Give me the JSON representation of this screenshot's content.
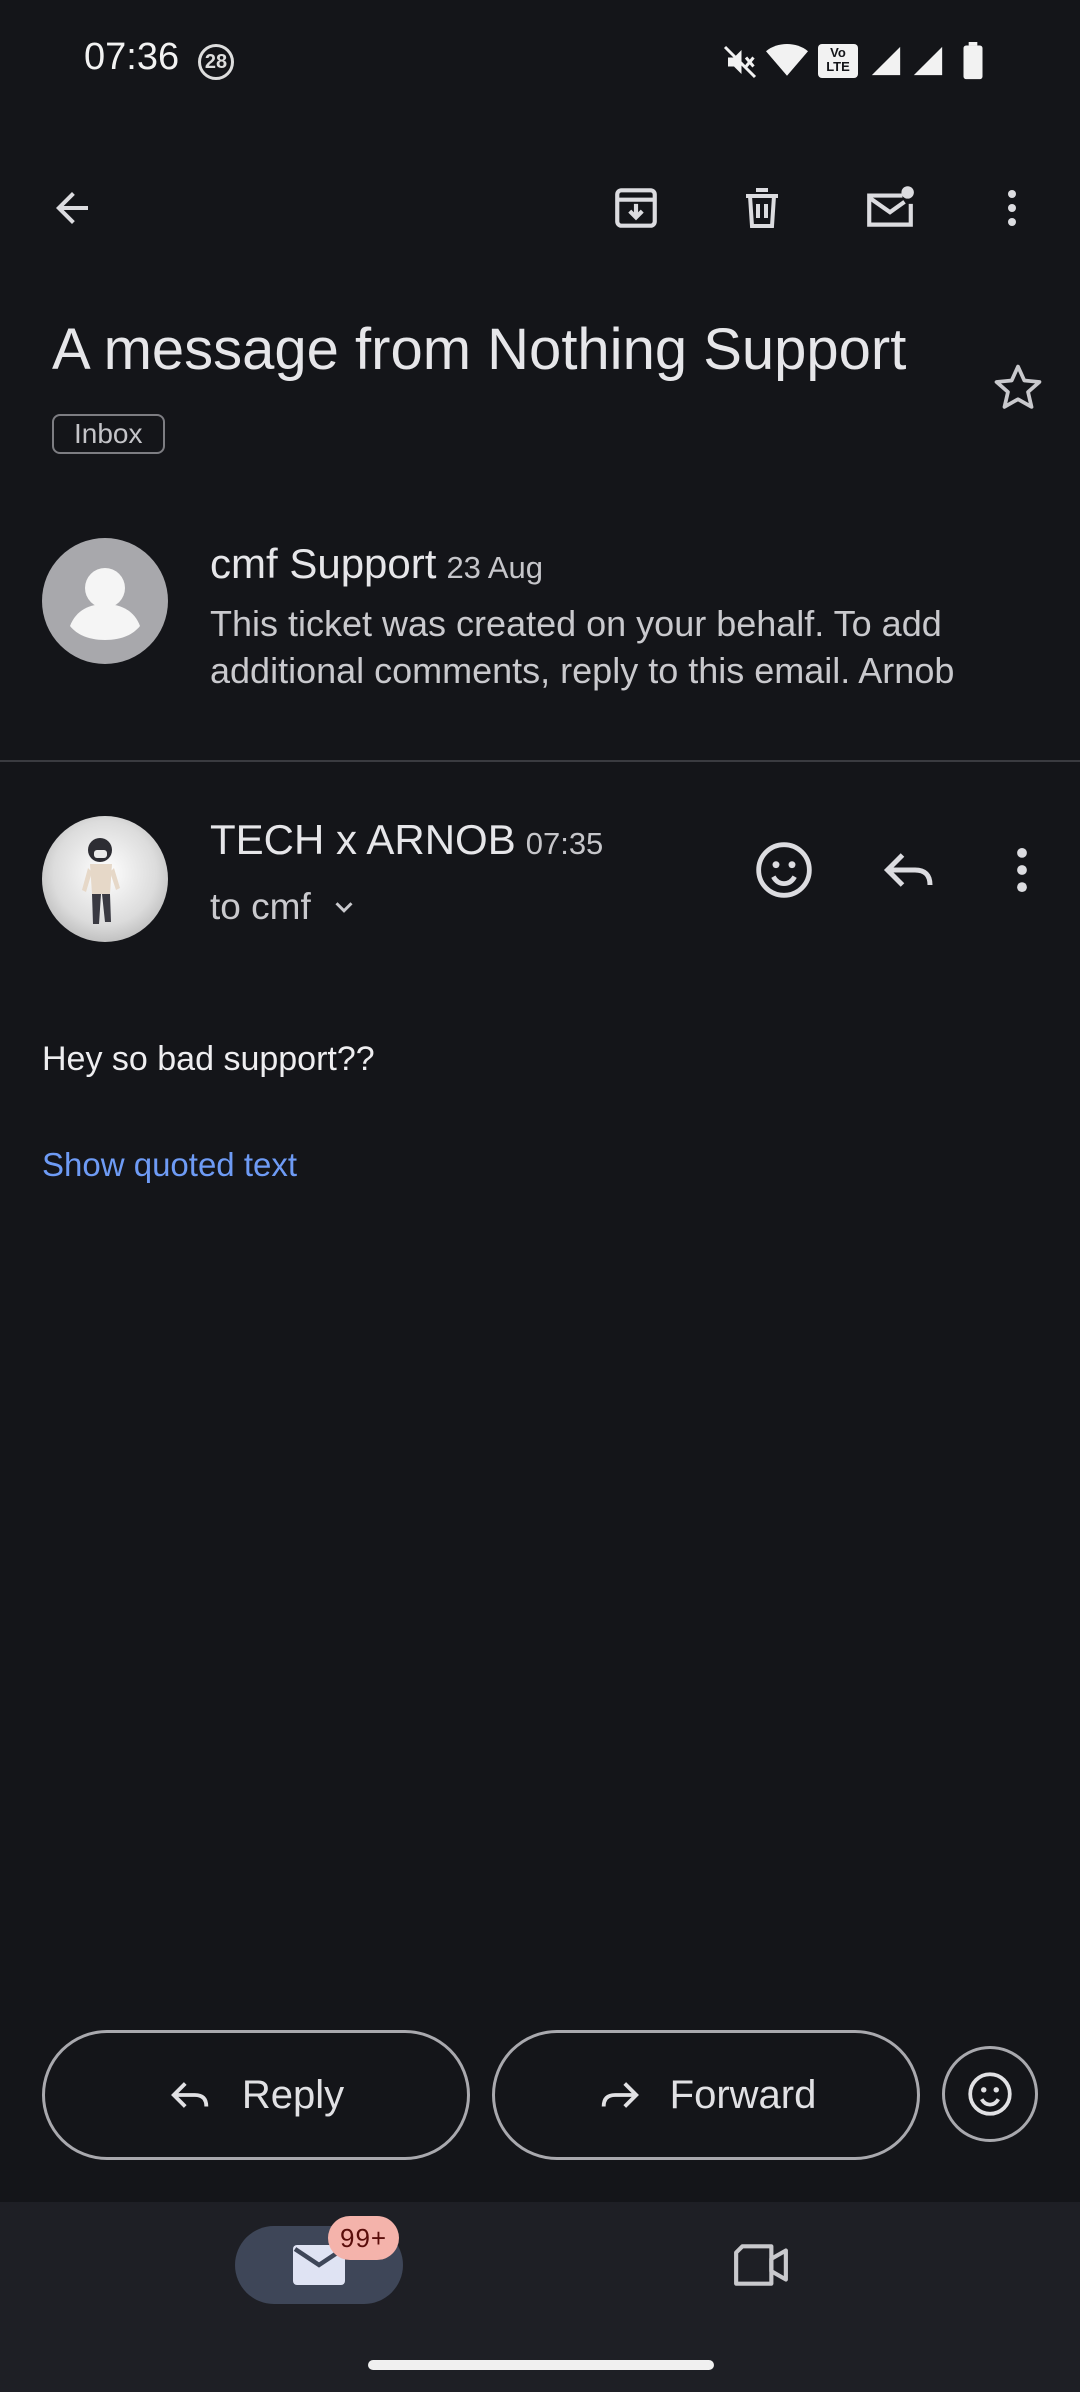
{
  "status_bar": {
    "time": "07:36",
    "notification_badge": "28",
    "icons": [
      "mute-icon",
      "wifi-icon",
      "volte-icon",
      "signal-icon",
      "signal-icon",
      "battery-icon"
    ]
  },
  "toolbar": {
    "icons": [
      "back-arrow-icon",
      "archive-icon",
      "delete-icon",
      "mark-unread-icon",
      "more-vert-icon"
    ]
  },
  "thread": {
    "subject": "A message from Nothing Support",
    "label": "Inbox"
  },
  "messages": [
    {
      "sender": "cmf Support",
      "date": "23 Aug",
      "snippet": "This ticket was created on your behalf. To add additional comments, reply to this email. Arnob"
    },
    {
      "sender": "TECH x ARNOB",
      "time": "07:35",
      "recipient": "to cmf",
      "body": "Hey so bad support??",
      "show_quoted": "Show quoted text"
    }
  ],
  "actions": {
    "reply": "Reply",
    "forward": "Forward"
  },
  "bottom_nav": {
    "mail_badge": "99+"
  },
  "colors": {
    "background": "#141519",
    "link": "#6e9bf5",
    "badge": "#f4b3ab",
    "nav_active": "#3e4658"
  }
}
